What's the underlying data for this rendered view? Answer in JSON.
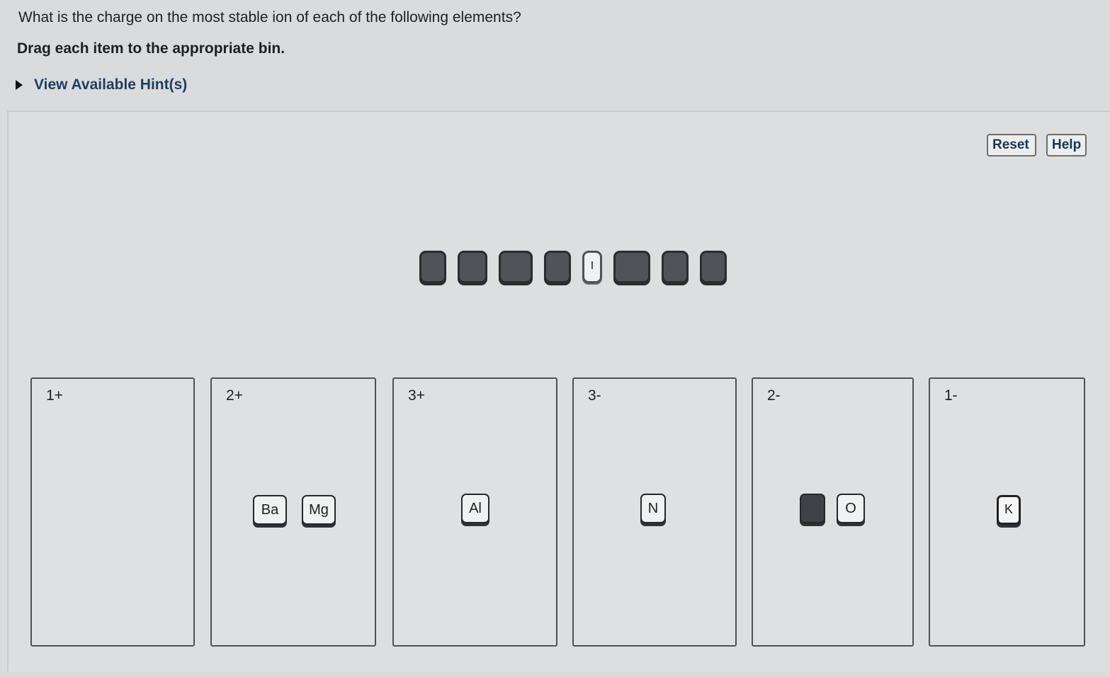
{
  "question": "What is the charge on the most stable ion of each of the following elements?",
  "instruction": "Drag each item to the appropriate bin.",
  "hint_link": "View Available Hint(s)",
  "toolbar": {
    "reset": "Reset",
    "help": "Help"
  },
  "pool_item_label": "I",
  "bins": [
    {
      "label": "1+",
      "items": []
    },
    {
      "label": "2+",
      "items": [
        "Ba",
        "Mg"
      ]
    },
    {
      "label": "3+",
      "items": [
        "Al"
      ]
    },
    {
      "label": "3-",
      "items": [
        "N"
      ]
    },
    {
      "label": "2-",
      "items": [
        "",
        "O"
      ]
    },
    {
      "label": "1-",
      "items": [
        "K"
      ]
    }
  ]
}
